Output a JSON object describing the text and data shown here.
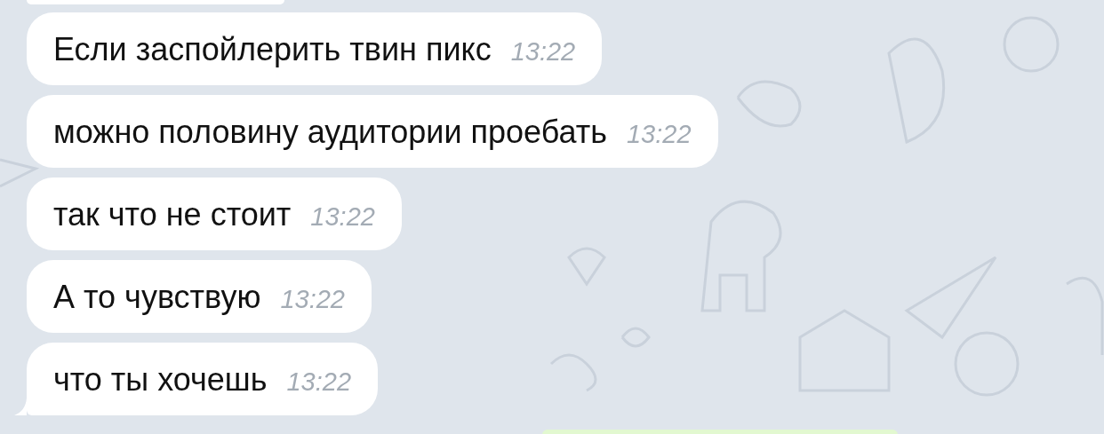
{
  "messages": [
    {
      "text": "Если заспойлерить твин пикс",
      "time": "13:22",
      "tail": false
    },
    {
      "text": "можно половину аудитории проебать",
      "time": "13:22",
      "tail": false
    },
    {
      "text": "так что не стоит",
      "time": "13:22",
      "tail": false
    },
    {
      "text": "А то чувствую",
      "time": "13:22",
      "tail": false
    },
    {
      "text": "что ты хочешь",
      "time": "13:22",
      "tail": true
    }
  ]
}
